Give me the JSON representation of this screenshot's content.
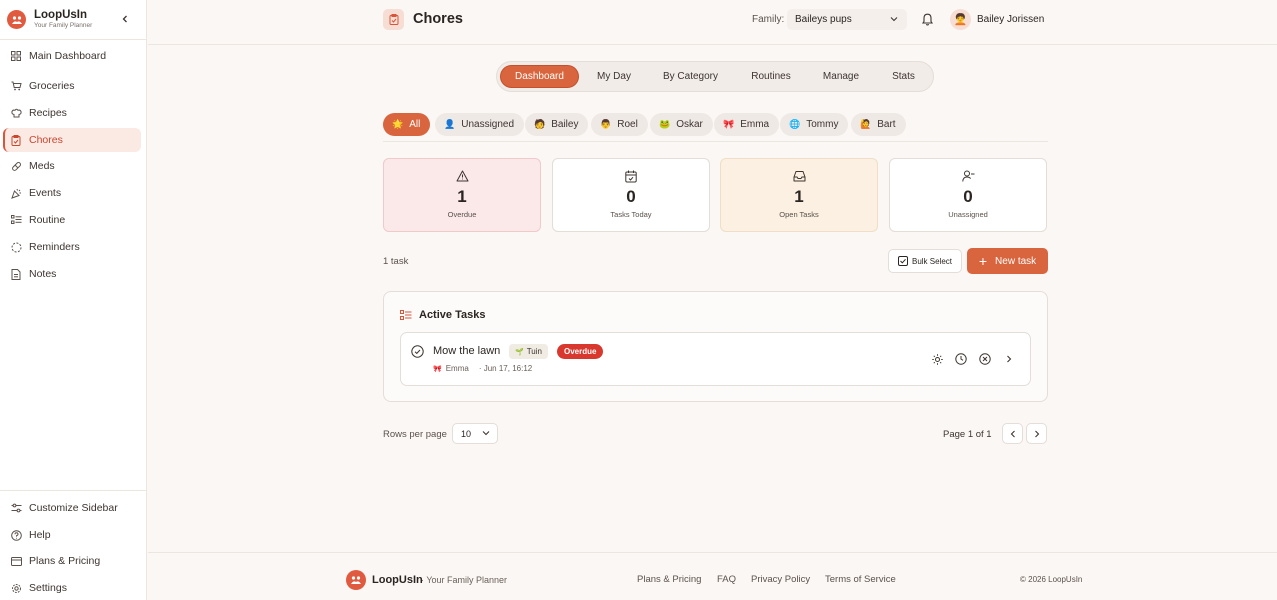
{
  "brand": {
    "name": "LoopUsIn",
    "tagline": "Your Family Planner"
  },
  "sidebar": {
    "items": [
      {
        "label": "Main Dashboard",
        "icon": "grid-icon"
      },
      {
        "label": "Groceries",
        "icon": "cart-icon"
      },
      {
        "label": "Recipes",
        "icon": "chef-hat-icon"
      },
      {
        "label": "Chores",
        "icon": "clipboard-icon",
        "active": true
      },
      {
        "label": "Meds",
        "icon": "pill-icon"
      },
      {
        "label": "Events",
        "icon": "party-icon"
      },
      {
        "label": "Routine",
        "icon": "list-check-icon"
      },
      {
        "label": "Reminders",
        "icon": "dashed-circle-icon"
      },
      {
        "label": "Notes",
        "icon": "note-icon"
      }
    ],
    "bottom_items": [
      {
        "label": "Customize Sidebar",
        "icon": "sliders-icon"
      },
      {
        "label": "Help",
        "icon": "help-icon"
      },
      {
        "label": "Plans & Pricing",
        "icon": "credit-card-icon"
      },
      {
        "label": "Settings",
        "icon": "gear-icon"
      }
    ]
  },
  "header": {
    "title": "Chores",
    "family_label": "Family:",
    "family_value": "Baileys pups",
    "user_name": "Bailey Jorissen",
    "user_avatar": "🧑‍🦱"
  },
  "tabs": [
    {
      "label": "Dashboard",
      "active": true
    },
    {
      "label": "My Day"
    },
    {
      "label": "By Category"
    },
    {
      "label": "Routines"
    },
    {
      "label": "Manage"
    },
    {
      "label": "Stats"
    }
  ],
  "filters": [
    {
      "label": "All",
      "emoji": "🌟",
      "active": true
    },
    {
      "label": "Unassigned",
      "emoji": "👤"
    },
    {
      "label": "Bailey",
      "emoji": "🧑"
    },
    {
      "label": "Roel",
      "emoji": "👨"
    },
    {
      "label": "Oskar",
      "emoji": "🐸"
    },
    {
      "label": "Emma",
      "emoji": "🎀"
    },
    {
      "label": "Tommy",
      "emoji": "🌐"
    },
    {
      "label": "Bart",
      "emoji": "🙋"
    }
  ],
  "stats": [
    {
      "value": "1",
      "label": "Overdue"
    },
    {
      "value": "0",
      "label": "Tasks Today"
    },
    {
      "value": "1",
      "label": "Open Tasks"
    },
    {
      "value": "0",
      "label": "Unassigned"
    }
  ],
  "toolbar": {
    "task_count": "1 task",
    "bulk_label": "Bulk Select",
    "new_label": "New task"
  },
  "active_tasks": {
    "title": "Active Tasks",
    "tasks": [
      {
        "title": "Mow the lawn",
        "category": "Tuin",
        "category_emoji": "🌱",
        "status": "Overdue",
        "assignee": "Emma",
        "assignee_emoji": "🎀",
        "due": "· Jun 17, 16:12"
      }
    ]
  },
  "pagination": {
    "rows_label": "Rows per page",
    "rows_value": "10",
    "page_info": "Page 1 of 1"
  },
  "footer": {
    "brand": "LoopUsIn",
    "tagline": "· Your Family Planner",
    "links": [
      "Plans & Pricing",
      "FAQ",
      "Privacy Policy",
      "Terms of Service"
    ],
    "copyright": "© 2026 LoopUsIn"
  },
  "colors": {
    "accent": "#d9653e",
    "overdue_badge": "#d9382e",
    "overdue_card": "#fbe9e9",
    "open_card": "#fbf0e1",
    "background": "#fbf7f4"
  }
}
